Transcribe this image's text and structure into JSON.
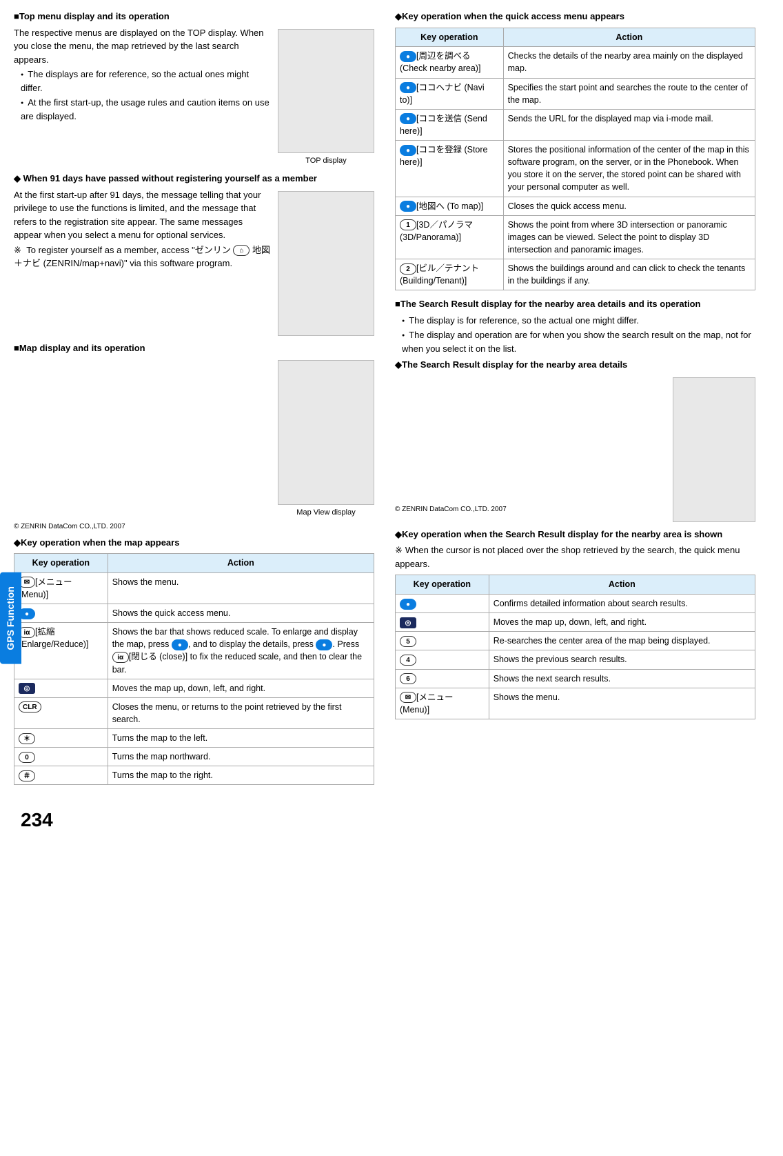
{
  "sideTab": "GPS Function",
  "pageNumber": "234",
  "left": {
    "h1": "■Top menu display and its operation",
    "p1": "The respective menus are displayed on the TOP display. When you close the menu, the map retrieved by the last search appears.",
    "b1": "The displays are for reference, so the actual ones might differ.",
    "b2": "At the first start-up, the usage rules and caution items on use are displayed.",
    "imgCap1": "TOP display",
    "h2": "◆ When 91 days have passed without registering yourself as a member",
    "p2": "At the first start-up after 91 days, the message telling that your privilege to use the functions is limited, and the message that refers to the registration site appear. The same messages appear when you select a menu for optional services.",
    "p3a": "To register yourself as a member, access \"ゼンリン ",
    "p3b": " 地図＋ナビ (ZENRIN/map+navi)\" via this software program.",
    "h3": "■Map display and its operation",
    "copyright": "© ZENRIN DataCom CO.,LTD. 2007",
    "imgCap2": "Map View display",
    "h4": "◆Key operation when the map appears",
    "table1": {
      "hKey": "Key operation",
      "hAct": "Action",
      "rows": [
        {
          "key": "envelope",
          "keyText": "[メニュー (Menu)]",
          "act": "Shows the menu."
        },
        {
          "key": "blue-dot",
          "keyText": "",
          "act": "Shows the quick access menu."
        },
        {
          "key": "i-alpha",
          "keyText": "[拡縮 (Enlarge/Reduce)]",
          "act": "Shows the bar that shows reduced scale. To enlarge and display the map, press     , and to display the details, press     . Press     [閉じる (close)] to fix the reduced scale, and then to clear the bar.",
          "hasInline": true
        },
        {
          "key": "sq",
          "keyText": "",
          "act": "Moves the map up, down, left, and right."
        },
        {
          "key": "clr",
          "keyText": "",
          "act": "Closes the menu, or returns to the point retrieved by the first search."
        },
        {
          "key": "star",
          "keyText": "",
          "act": "Turns the map to the left."
        },
        {
          "key": "zero",
          "keyText": "",
          "act": "Turns the map northward."
        },
        {
          "key": "hash",
          "keyText": "",
          "act": "Turns the map to the right."
        }
      ]
    }
  },
  "right": {
    "h1": "◆Key operation when the quick access menu appears",
    "table2": {
      "hKey": "Key operation",
      "hAct": "Action",
      "rows": [
        {
          "key": "blue-dot",
          "keyText": "[周辺を調べる (Check nearby area)]",
          "act": "Checks the details of the nearby area mainly on the displayed map."
        },
        {
          "key": "blue-dot",
          "keyText": "[ココへナビ (Navi to)]",
          "act": "Specifies the start point and searches the route to the center of the map."
        },
        {
          "key": "blue-dot",
          "keyText": "[ココを送信 (Send here)]",
          "act": "Sends the URL for the displayed map via i-mode mail."
        },
        {
          "key": "blue-dot",
          "keyText": "[ココを登録 (Store here)]",
          "act": "Stores the positional information of the center of the map in this software program, on the server, or in the Phonebook. When you store it on the server, the stored point can be shared with your personal computer as well."
        },
        {
          "key": "blue-dot",
          "keyText": "[地図へ (To map)]",
          "act": "Closes the quick access menu."
        },
        {
          "key": "one",
          "keyText": "[3D／パノラマ (3D/Panorama)]",
          "act": "Shows the point from where 3D intersection or panoramic images can be viewed. Select the point to display 3D intersection and panoramic images."
        },
        {
          "key": "two",
          "keyText": "[ビル／テナント (Building/Tenant)]",
          "act": "Shows the buildings around and can click to check the tenants in the buildings if any."
        }
      ]
    },
    "h2": "■The Search Result display for the nearby area details and its operation",
    "b1": "The display is for reference, so the actual one might differ.",
    "b2": "The display and operation are for when you show the search result on the map, not for when you select it on the list.",
    "h3": "◆The Search Result display for the nearby area details",
    "copyright": "© ZENRIN DataCom CO.,LTD. 2007",
    "h4": "◆Key operation when the Search Result display for the nearby area is shown",
    "p1": "When the cursor is not placed over the shop retrieved by the search, the quick menu appears.",
    "table3": {
      "hKey": "Key operation",
      "hAct": "Action",
      "rows": [
        {
          "key": "blue-dot",
          "act": "Confirms detailed information about search results."
        },
        {
          "key": "sq",
          "act": "Moves the map up, down, left, and right."
        },
        {
          "key": "five",
          "act": "Re-searches the center area of the map being displayed."
        },
        {
          "key": "four",
          "act": "Shows the previous search results."
        },
        {
          "key": "six",
          "act": "Shows the next search results."
        },
        {
          "key": "envelope",
          "keyText": "[メニュー (Menu)]",
          "act": "Shows the menu."
        }
      ]
    }
  }
}
